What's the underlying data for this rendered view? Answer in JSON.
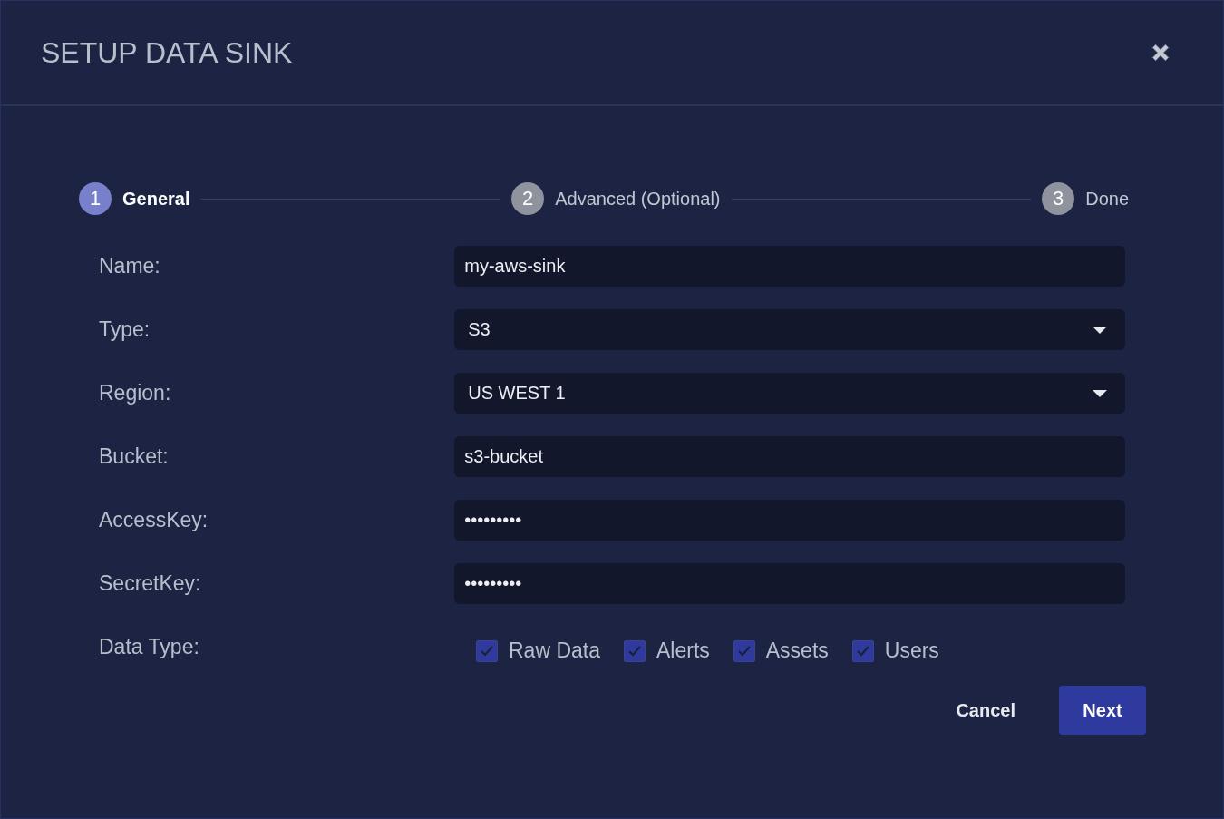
{
  "dialog": {
    "title": "SETUP DATA SINK"
  },
  "steps": [
    {
      "number": "1",
      "label": "General",
      "selected": true
    },
    {
      "number": "2",
      "label": "Advanced (Optional)",
      "selected": false
    },
    {
      "number": "3",
      "label": "Done",
      "selected": false
    }
  ],
  "fields": [
    {
      "label": "Name:",
      "kind": "text",
      "value": "my-aws-sink"
    },
    {
      "label": "Type:",
      "kind": "select",
      "value": "S3"
    },
    {
      "label": "Region:",
      "kind": "select",
      "value": "US WEST 1"
    },
    {
      "label": "Bucket:",
      "kind": "text",
      "value": "s3-bucket"
    },
    {
      "label": "AccessKey:",
      "kind": "text",
      "value": "•••••••••"
    },
    {
      "label": "SecretKey:",
      "kind": "text",
      "value": "•••••••••"
    }
  ],
  "data_type": {
    "label": "Data Type:",
    "options": [
      {
        "label": "Raw Data",
        "checked": true
      },
      {
        "label": "Alerts",
        "checked": true
      },
      {
        "label": "Assets",
        "checked": true
      },
      {
        "label": "Users",
        "checked": true
      }
    ]
  },
  "buttons": [
    {
      "label": "Cancel",
      "kind": "flat"
    },
    {
      "label": "Next",
      "kind": "primary"
    }
  ]
}
